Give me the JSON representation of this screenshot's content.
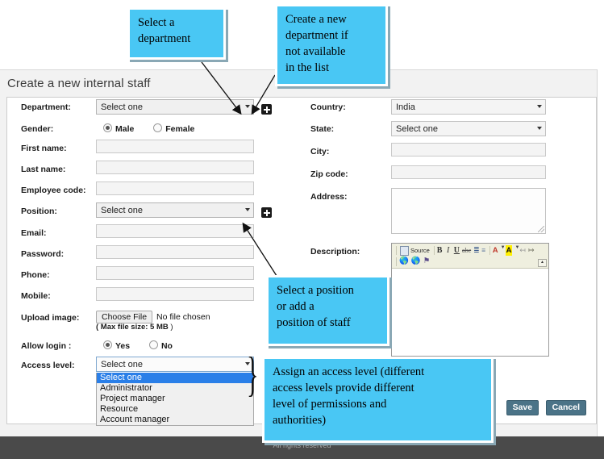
{
  "page": {
    "title": "Create a new internal staff",
    "footer": "All rights reserved"
  },
  "accent": {
    "callout_bg": "#49c7f4",
    "callout_border": "#ffffff",
    "callout_shadow": "#8aa8b5",
    "button_bg": "#4b7387",
    "highlight_blue": "#2a7fe8",
    "toolbar_bg": "#efefdf"
  },
  "form": {
    "left": {
      "department": {
        "label": "Department:",
        "value": "Select one",
        "add_icon": "plus-icon"
      },
      "gender": {
        "label": "Gender:",
        "options": [
          "Male",
          "Female"
        ],
        "selected": "Male"
      },
      "first_name": {
        "label": "First name:",
        "value": ""
      },
      "last_name": {
        "label": "Last name:",
        "value": ""
      },
      "employee_code": {
        "label": "Employee code:",
        "value": ""
      },
      "position": {
        "label": "Position:",
        "value": "Select one",
        "add_icon": "plus-icon"
      },
      "email": {
        "label": "Email:",
        "value": ""
      },
      "password": {
        "label": "Password:",
        "value": ""
      },
      "phone": {
        "label": "Phone:",
        "value": ""
      },
      "mobile": {
        "label": "Mobile:",
        "value": ""
      },
      "upload_image": {
        "label": "Upload image:",
        "button": "Choose File",
        "status": "No file chosen",
        "note_bold": "( Max file size: 5 MB",
        "note_tail": " )"
      },
      "allow_login": {
        "label": "Allow login :",
        "options": [
          "Yes",
          "No"
        ],
        "selected": "Yes"
      },
      "access_level": {
        "label": "Access level:",
        "value": "Select one",
        "options": [
          "Select one",
          "Administrator",
          "Project manager",
          "Resource",
          "Account manager"
        ],
        "highlighted": "Select one",
        "expanded": true
      }
    },
    "right": {
      "country": {
        "label": "Country:",
        "value": "India"
      },
      "state": {
        "label": "State:",
        "value": "Select one"
      },
      "city": {
        "label": "City:",
        "value": ""
      },
      "zip_code": {
        "label": "Zip code:",
        "value": ""
      },
      "address": {
        "label": "Address:",
        "value": ""
      },
      "description": {
        "label": "Description:",
        "value": "",
        "toolbar_row1": [
          "source-icon",
          "Source",
          "bold-icon",
          "italic-icon",
          "underline-icon",
          "strikethrough-icon",
          "numbered-list-icon",
          "bulleted-list-icon",
          "text-color-icon",
          "background-color-icon",
          "decrease-indent-icon",
          "increase-indent-icon"
        ],
        "toolbar_row2": [
          "link-icon",
          "unlink-icon",
          "anchor-icon"
        ],
        "source_label": "Source",
        "collapse_icon": "collapse-toolbar-icon"
      }
    }
  },
  "actions": {
    "save": "Save",
    "cancel": "Cancel"
  },
  "callouts": {
    "department": "Select a\ndepartment",
    "new_department": "Create a new\ndepartment if\nnot available\nin the list",
    "position": "Select a position\nor add a\nposition of staff",
    "access_level": "Assign an access level (different\naccess levels provide different\nlevel of permissions and\nauthorities)"
  }
}
